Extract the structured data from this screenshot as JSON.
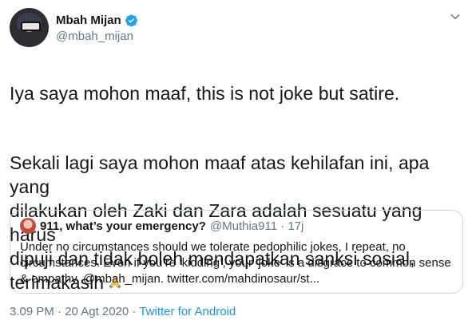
{
  "author": {
    "display_name": "Mbah Mijan",
    "handle": "@mbah_mijan"
  },
  "tweet": {
    "paragraph_1": "Iya saya mohon maaf, this is not joke but satire.",
    "paragraph_2": "Sekali lagi saya mohon maaf atas kehilafan ini, apa yang\ndilakukan oleh Zaki dan Zara adalah sesuatu yang harus\ndipuji dan tidak boleh mendapatkan sanksi sosial,\nterimakasih",
    "emoji": "folded-hands"
  },
  "quoted_tweet": {
    "display_name": "911, what’s your emergency?",
    "meta": "@Muthia911 · 17j",
    "text": "Under no circumstances should we tolerate pedophilic jokes, I repeat, no circumstances. Even if you’re ‘kidding’, your ‘joke’ is a disgrace to common sense & empathy, @mbah_mijan. twitter.com/mahdinosaur/st..."
  },
  "footer": {
    "timestamp": "3.09 PM · 20 Agt 2020 · ",
    "source": "Twitter for Android"
  },
  "colors": {
    "accent": "#1b95e0",
    "secondary_text": "#657786",
    "border": "#ccd6dd"
  },
  "icons": [
    "verified-badge-icon",
    "chevron-down-icon",
    "folded-hands-emoji"
  ]
}
